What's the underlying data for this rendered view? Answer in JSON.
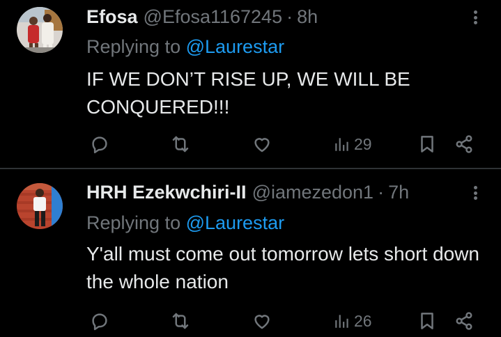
{
  "colors": {
    "background": "#000000",
    "primary_text": "#e7e9ea",
    "secondary_text": "#71767b",
    "link": "#1d9bf0",
    "divider": "#2f3336"
  },
  "tweets": [
    {
      "display_name": "Efosa",
      "handle": "@Efosa1167245",
      "separator": "·",
      "time": "8h",
      "replying_prefix": "Replying to",
      "replying_to": "@Laurestar",
      "text": "IF WE DON’T RISE UP, WE WILL BE CONQUERED!!!",
      "views": "29",
      "icons": [
        "more-icon",
        "reply-icon",
        "retweet-icon",
        "like-icon",
        "views-icon",
        "bookmark-icon",
        "share-icon"
      ]
    },
    {
      "display_name": "HRH Ezekwchiri-II",
      "handle": "@iamezedon1",
      "separator": "·",
      "time": "7h",
      "replying_prefix": "Replying to",
      "replying_to": "@Laurestar",
      "text": "Y'all must come out tomorrow lets short down the whole nation",
      "views": "26",
      "icons": [
        "more-icon",
        "reply-icon",
        "retweet-icon",
        "like-icon",
        "views-icon",
        "bookmark-icon",
        "share-icon"
      ]
    }
  ]
}
